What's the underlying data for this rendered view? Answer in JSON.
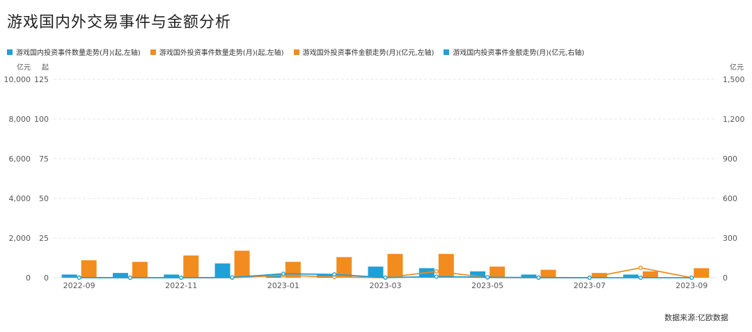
{
  "title": "游戏国内外交易事件与金额分析",
  "source": "数据来源:亿欧数据",
  "legend": [
    {
      "label": "游戏国内投资事件数量走势(月)(起,左轴)",
      "color": "#1fa0d6"
    },
    {
      "label": "游戏国外投资事件数量走势(月)(起,左轴)",
      "color": "#f28c1e"
    },
    {
      "label": "游戏国外投资事件金额走势(月)(亿元,左轴)",
      "color": "#f28c1e"
    },
    {
      "label": "游戏国内投资事件金额走势(月)(亿元,右轴)",
      "color": "#1fa0d6"
    }
  ],
  "axis_units": {
    "left_outer": "亿元",
    "left_inner": "起",
    "right": "亿元"
  },
  "chart_data": {
    "type": "bar",
    "categories": [
      "2022-09",
      "2022-10",
      "2022-11",
      "2022-12",
      "2023-01",
      "2023-02",
      "2023-03",
      "2023-04",
      "2023-05",
      "2023-06",
      "2023-07",
      "2023-08",
      "2023-09"
    ],
    "x_tick_labels": [
      "2022-09",
      "2022-11",
      "2023-01",
      "2023-03",
      "2023-05",
      "2023-07",
      "2023-09"
    ],
    "y_left_outer_ticks": [
      "0",
      "2,000",
      "4,000",
      "6,000",
      "8,000",
      "10,000"
    ],
    "y_left_inner_ticks": [
      "0",
      "25",
      "50",
      "75",
      "100",
      "125"
    ],
    "y_right_ticks": [
      "0",
      "300",
      "600",
      "900",
      "1,200",
      "1,500"
    ],
    "ylim_count": [
      0,
      125
    ],
    "ylim_amount_left": [
      0,
      10000
    ],
    "ylim_amount_right": [
      0,
      1500
    ],
    "series": [
      {
        "name": "游戏国内投资事件数量走势(月)(起,左轴)",
        "kind": "bar",
        "axis": "count",
        "color": "#1fa0d6",
        "values": [
          2,
          3,
          2,
          9,
          2,
          2,
          7,
          6,
          4,
          2,
          0,
          2,
          0
        ]
      },
      {
        "name": "游戏国外投资事件数量走势(月)(起,左轴)",
        "kind": "bar",
        "axis": "count",
        "color": "#f28c1e",
        "values": [
          11,
          10,
          14,
          17,
          10,
          13,
          15,
          15,
          7,
          5,
          3,
          4,
          6
        ]
      },
      {
        "name": "游戏国外投资事件金额走势(月)(亿元,左轴)",
        "kind": "line",
        "axis": "amount_left",
        "color": "#f28c1e",
        "values": [
          10,
          0,
          0,
          0,
          120,
          40,
          0,
          320,
          10,
          0,
          0,
          500,
          0
        ]
      },
      {
        "name": "游戏国内投资事件金额走势(月)(亿元,右轴)",
        "kind": "line",
        "axis": "amount_right",
        "color": "#1fa0d6",
        "values": [
          0,
          0,
          0,
          2,
          30,
          25,
          1,
          8,
          3,
          1,
          0,
          0,
          0
        ]
      }
    ]
  }
}
